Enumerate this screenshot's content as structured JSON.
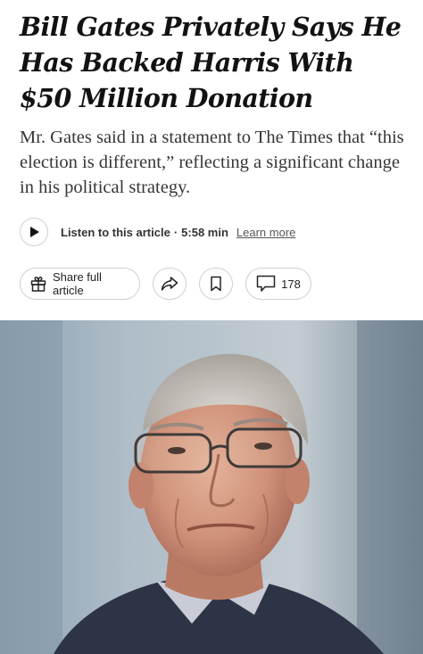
{
  "article": {
    "headline": "Bill Gates Privately Says He Has Backed Harris With $50 Million Donation",
    "summary": "Mr. Gates said in a statement to The Times that “this election is different,” reflecting a significant change in his political strategy."
  },
  "audio": {
    "label": "Listen to this article",
    "separator": "·",
    "duration": "5:58 min",
    "learn_more": "Learn more"
  },
  "actions": {
    "share_label": "Share full article",
    "comment_count": "178"
  },
  "icons": {
    "play": "play-icon",
    "gift": "gift-icon",
    "share": "share-arrow-icon",
    "bookmark": "bookmark-icon",
    "comment": "comment-bubble-icon"
  },
  "colors": {
    "text": "#121212",
    "summary_text": "#363636",
    "border": "#cfcfcf"
  }
}
